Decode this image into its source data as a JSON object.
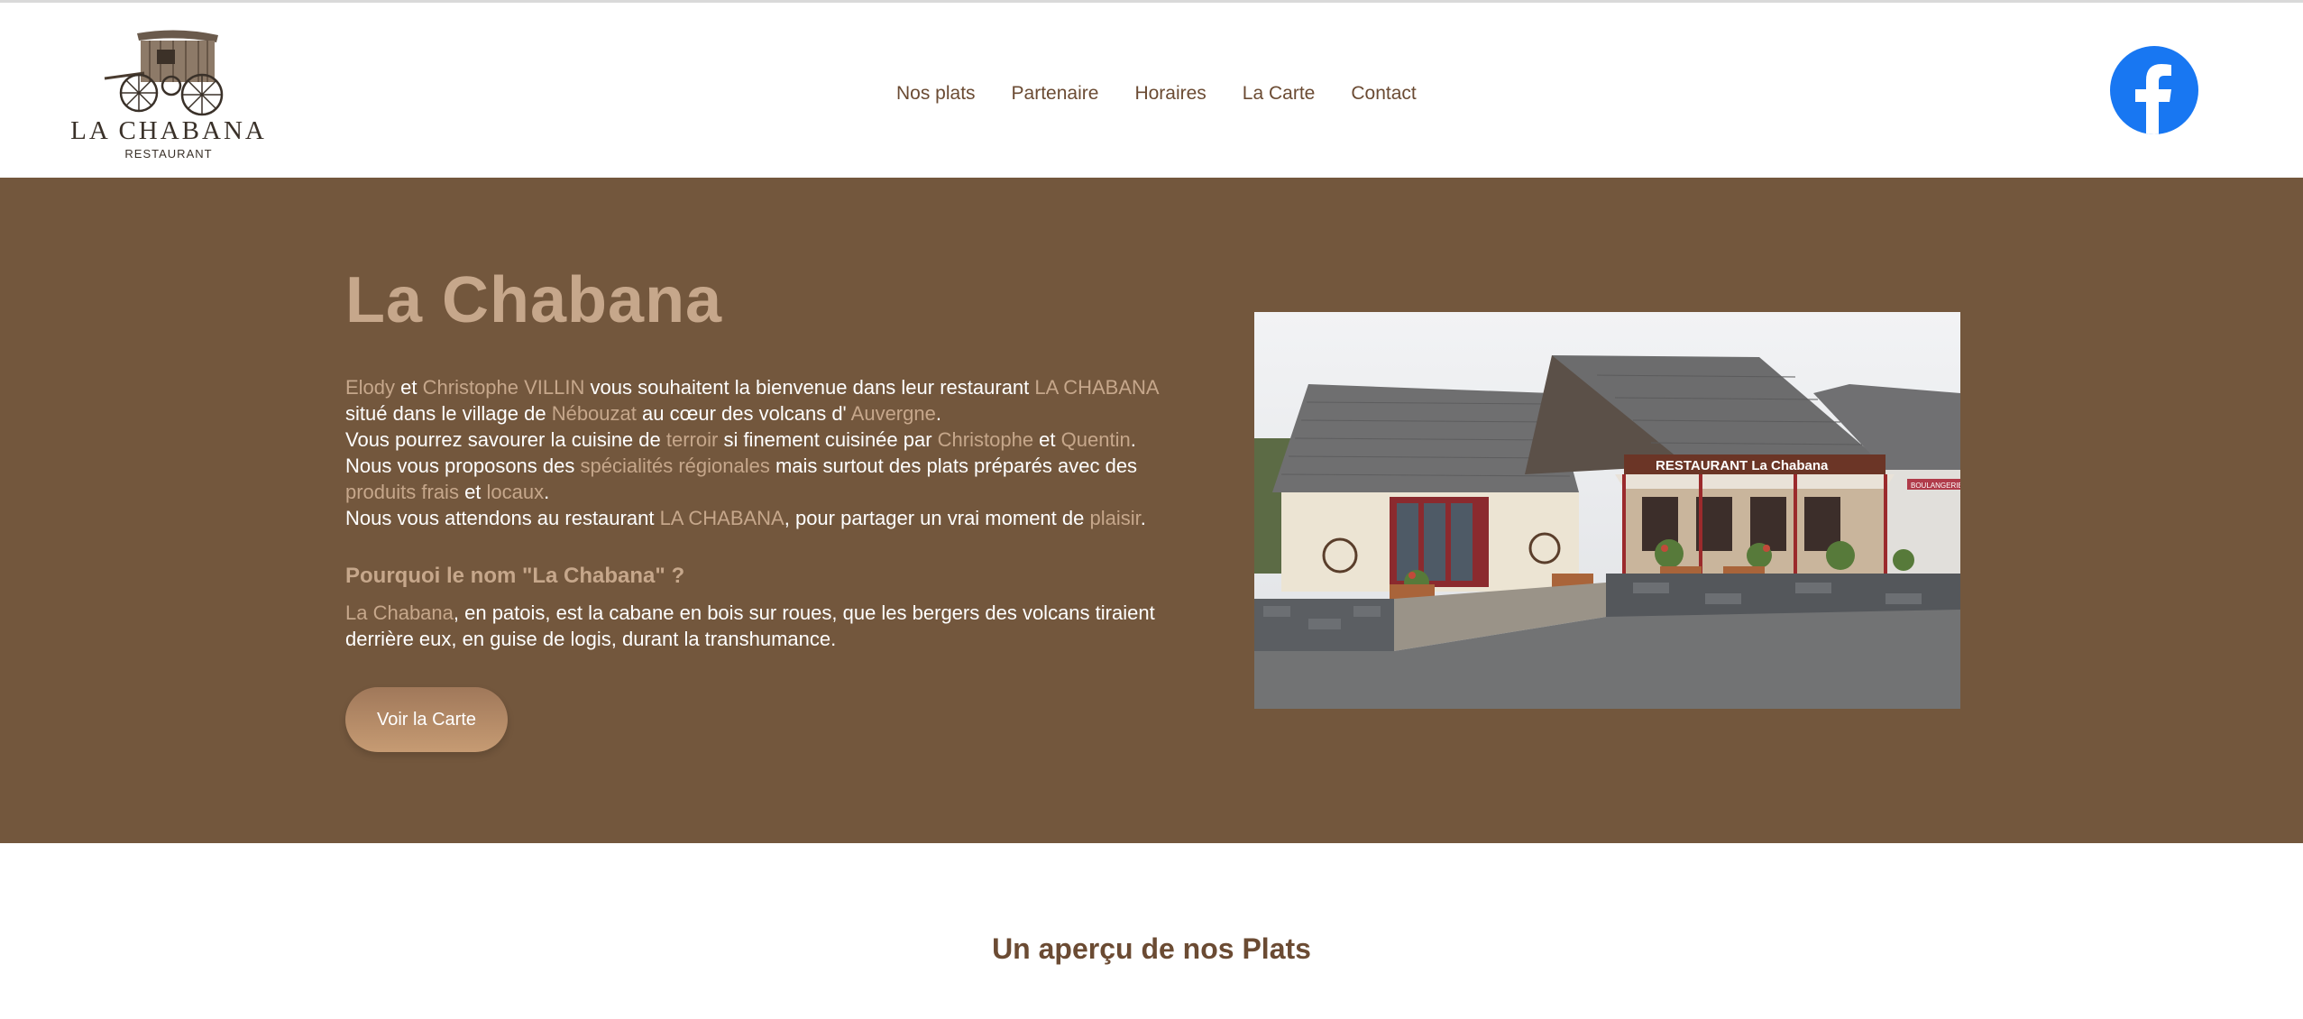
{
  "brand": {
    "name": "LA CHABANA",
    "subtitle": "RESTAURANT"
  },
  "nav": {
    "items": [
      "Nos plats",
      "Partenaire",
      "Horaires",
      "La Carte",
      "Contact"
    ]
  },
  "social": {
    "facebook_icon": "facebook-icon",
    "facebook_color": "#1877f2"
  },
  "hero": {
    "title": "La Chabana",
    "intro": {
      "l1": [
        "Elody",
        " et ",
        "Christophe VILLIN",
        " vous souhaitent la bienvenue dans leur restaurant ",
        "LA CHABANA"
      ],
      "l2": [
        "situé dans le village de ",
        "Nébouzat",
        " au cœur des volcans d' ",
        "Auvergne",
        "."
      ],
      "l3": [
        "Vous pourrez savourer la cuisine de ",
        "terroir",
        " si finement cuisinée par ",
        "Christophe",
        " et ",
        "Quentin",
        "."
      ],
      "l4": [
        "Nous vous proposons des ",
        "spécialités régionales",
        " mais surtout des plats préparés avec des"
      ],
      "l5": [
        "produits frais",
        " et ",
        "locaux",
        "."
      ],
      "l6": [
        "Nous vous attendons au restaurant ",
        "LA CHABANA",
        ", pour partager un vrai moment de ",
        "plaisir",
        "."
      ]
    },
    "why_title": "Pourquoi le nom \"La Chabana\" ?",
    "why_text": {
      "l1": [
        "La Chabana",
        ", en patois, est la cabane en bois sur roues, que les bergers des volcans tiraient"
      ],
      "l2": [
        "derrière eux, en guise de logis, durant la transhumance."
      ]
    },
    "button_label": "Voir la Carte",
    "photo": {
      "sign_text": "RESTAURANT  La Chabana",
      "shop_sign": "BOULANGERIE"
    }
  },
  "colors": {
    "hero_bg": "#73573d",
    "accent": "#c6a78b",
    "nav_text": "#6b4b33"
  },
  "section": {
    "title": "Un aperçu de nos Plats"
  }
}
